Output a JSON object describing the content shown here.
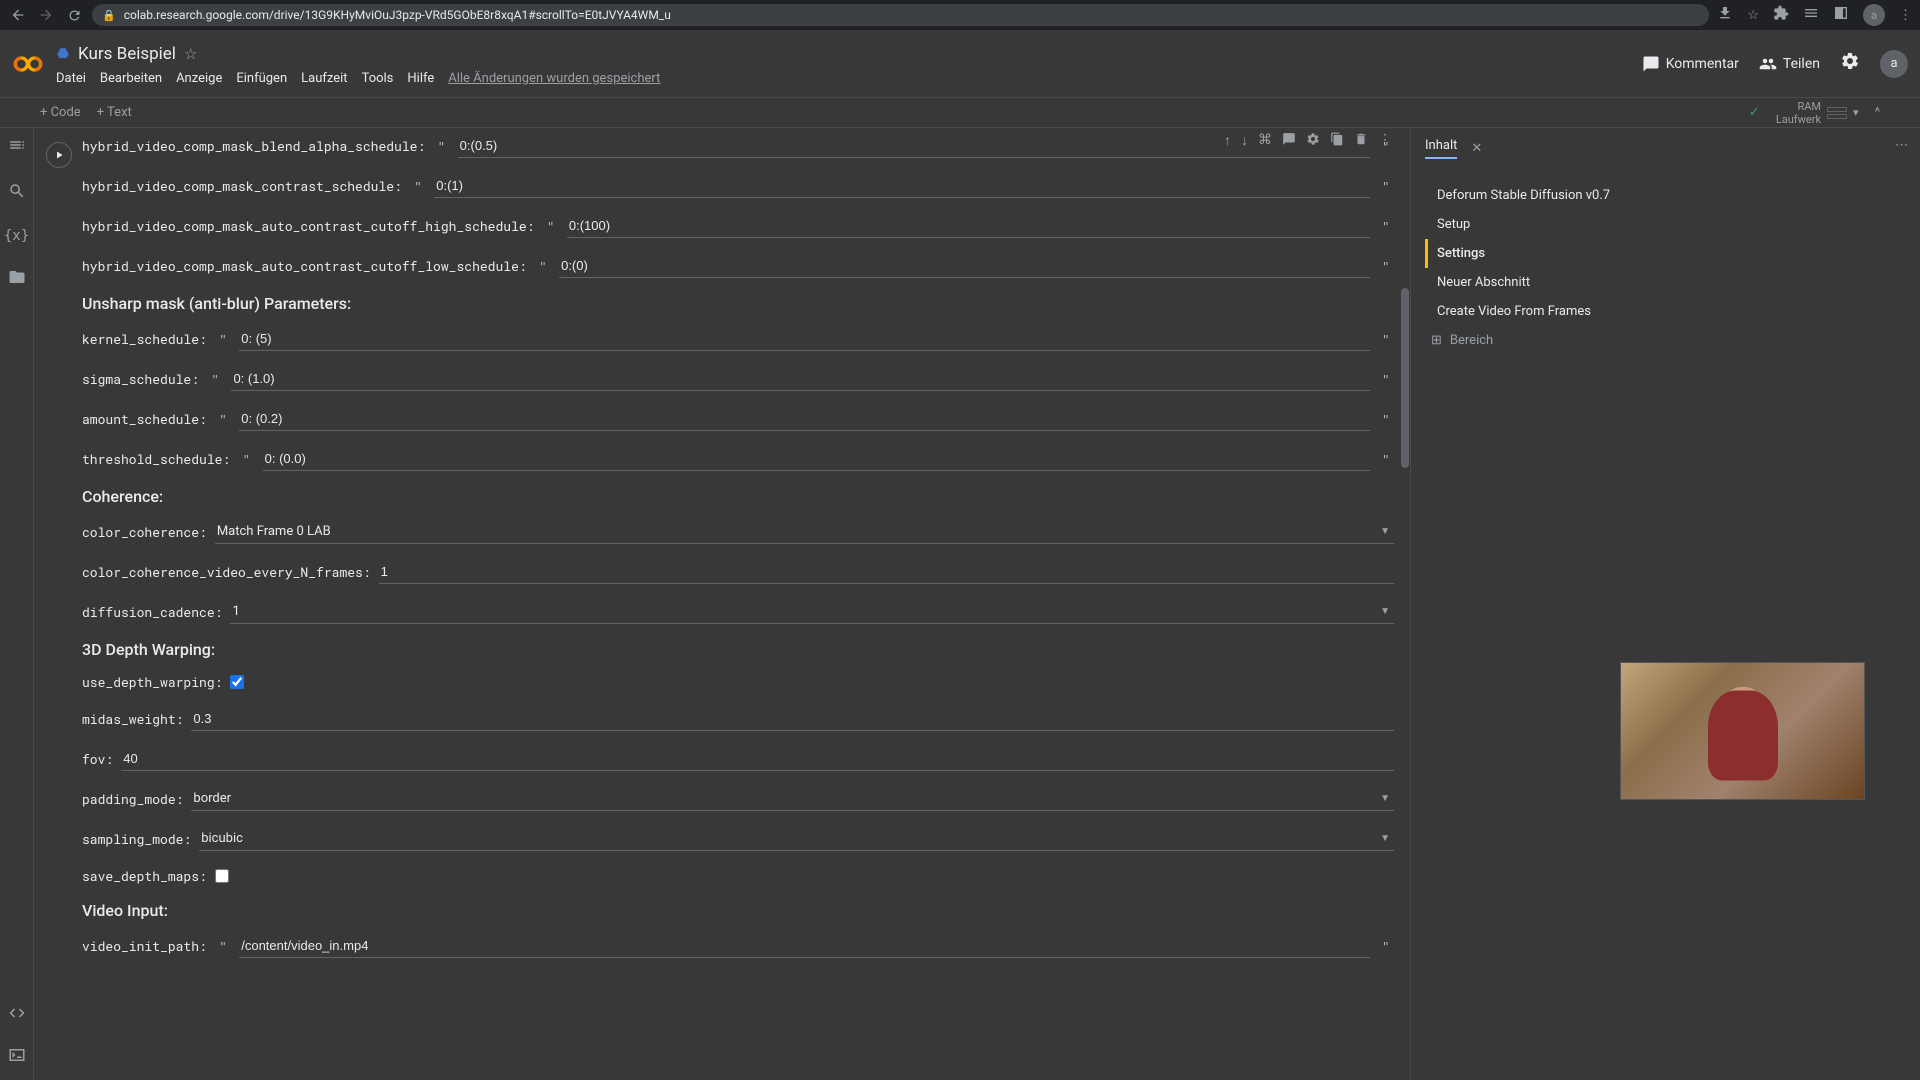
{
  "browser": {
    "url": "colab.research.google.com/drive/13G9KHyMviOuJ3pzp-VRd5GObE8r8xqA1#scrollTo=E0tJVYA4WM_u"
  },
  "header": {
    "title": "Kurs Beispiel",
    "menus": [
      "Datei",
      "Bearbeiten",
      "Anzeige",
      "Einfügen",
      "Laufzeit",
      "Tools",
      "Hilfe"
    ],
    "save_status": "Alle Änderungen wurden gespeichert",
    "comment": "Kommentar",
    "share": "Teilen",
    "avatar": "a"
  },
  "toolbar": {
    "add_code": "+ Code",
    "add_text": "+ Text",
    "ram": "RAM",
    "disk": "Laufwerk"
  },
  "form": {
    "rows": [
      {
        "label": "hybrid_video_comp_mask_blend_alpha_schedule:",
        "value": "0:(0.5)",
        "type": "string"
      },
      {
        "label": "hybrid_video_comp_mask_contrast_schedule:",
        "value": "0:(1)",
        "type": "string"
      },
      {
        "label": "hybrid_video_comp_mask_auto_contrast_cutoff_high_schedule:",
        "value": "0:(100)",
        "type": "string"
      },
      {
        "label": "hybrid_video_comp_mask_auto_contrast_cutoff_low_schedule:",
        "value": "0:(0)",
        "type": "string"
      }
    ],
    "section1": "Unsharp mask (anti-blur) Parameters:",
    "unsharp": [
      {
        "label": "kernel_schedule:",
        "value": "0: (5)",
        "type": "string"
      },
      {
        "label": "sigma_schedule:",
        "value": "0: (1.0)",
        "type": "string"
      },
      {
        "label": "amount_schedule:",
        "value": "0: (0.2)",
        "type": "string"
      },
      {
        "label": "threshold_schedule:",
        "value": "0: (0.0)",
        "type": "string"
      }
    ],
    "section2": "Coherence:",
    "coherence": {
      "color_coherence_label": "color_coherence:",
      "color_coherence_value": "Match Frame 0 LAB",
      "every_n_label": "color_coherence_video_every_N_frames:",
      "every_n_value": "1",
      "cadence_label": "diffusion_cadence:",
      "cadence_value": "1"
    },
    "section3": "3D Depth Warping:",
    "depth": {
      "use_depth_label": "use_depth_warping:",
      "midas_label": "midas_weight:",
      "midas_value": "0.3",
      "fov_label": "fov:",
      "fov_value": "40",
      "padding_label": "padding_mode:",
      "padding_value": "border",
      "sampling_label": "sampling_mode:",
      "sampling_value": "bicubic",
      "save_maps_label": "save_depth_maps:"
    },
    "section4": "Video Input:",
    "video": {
      "path_label": "video_init_path:",
      "path_value": "/content/video_in.mp4"
    }
  },
  "toc": {
    "title": "Inhalt",
    "items": [
      {
        "label": "Deforum Stable Diffusion v0.7",
        "active": false
      },
      {
        "label": "Setup",
        "active": false
      },
      {
        "label": "Settings",
        "active": true
      },
      {
        "label": "Neuer Abschnitt",
        "active": false
      },
      {
        "label": "Create Video From Frames",
        "active": false
      }
    ],
    "add_section": "Bereich"
  }
}
